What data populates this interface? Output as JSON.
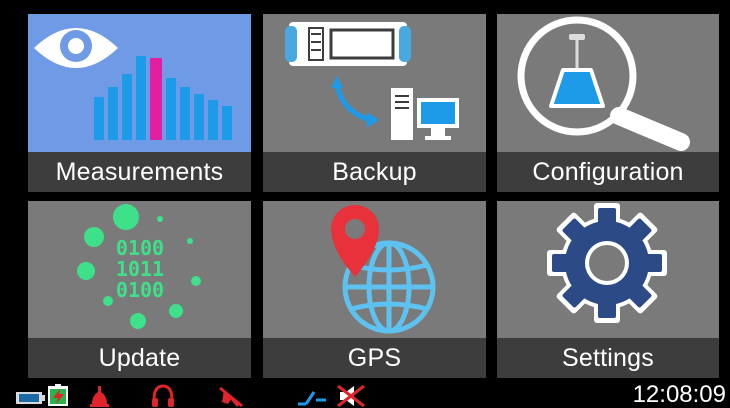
{
  "tiles": [
    {
      "label": "Measurements",
      "icon": "eye-bar-chart-icon",
      "selected": true
    },
    {
      "label": "Backup",
      "icon": "device-to-computer-sync-icon",
      "selected": false
    },
    {
      "label": "Configuration",
      "icon": "microphone-magnifier-icon",
      "selected": false
    },
    {
      "label": "Update",
      "icon": "binary-code-bubbles-icon",
      "selected": false
    },
    {
      "label": "GPS",
      "icon": "globe-location-pin-icon",
      "selected": false
    },
    {
      "label": "Settings",
      "icon": "gear-icon",
      "selected": false
    }
  ],
  "update_icon_text": [
    "0100",
    "1011",
    "0100"
  ],
  "status_bar": {
    "icons": [
      "battery-icon",
      "charging-icon",
      "bell-alarm-icon",
      "headphones-icon",
      "microphone-muted-icon",
      "signal-line-icon",
      "speaker-muted-icon"
    ],
    "clock": "12:08:09"
  },
  "colors": {
    "tile_bg": "#7a7a7a",
    "label_bg": "#3d3d3d",
    "selected_bg": "#6f9be6",
    "accent_blue": "#1e9be8",
    "accent_magenta": "#e21fa0",
    "accent_green": "#3ee08a",
    "accent_red": "#e8313a",
    "gear_blue": "#2c4a86",
    "status_red": "#e0242c"
  }
}
